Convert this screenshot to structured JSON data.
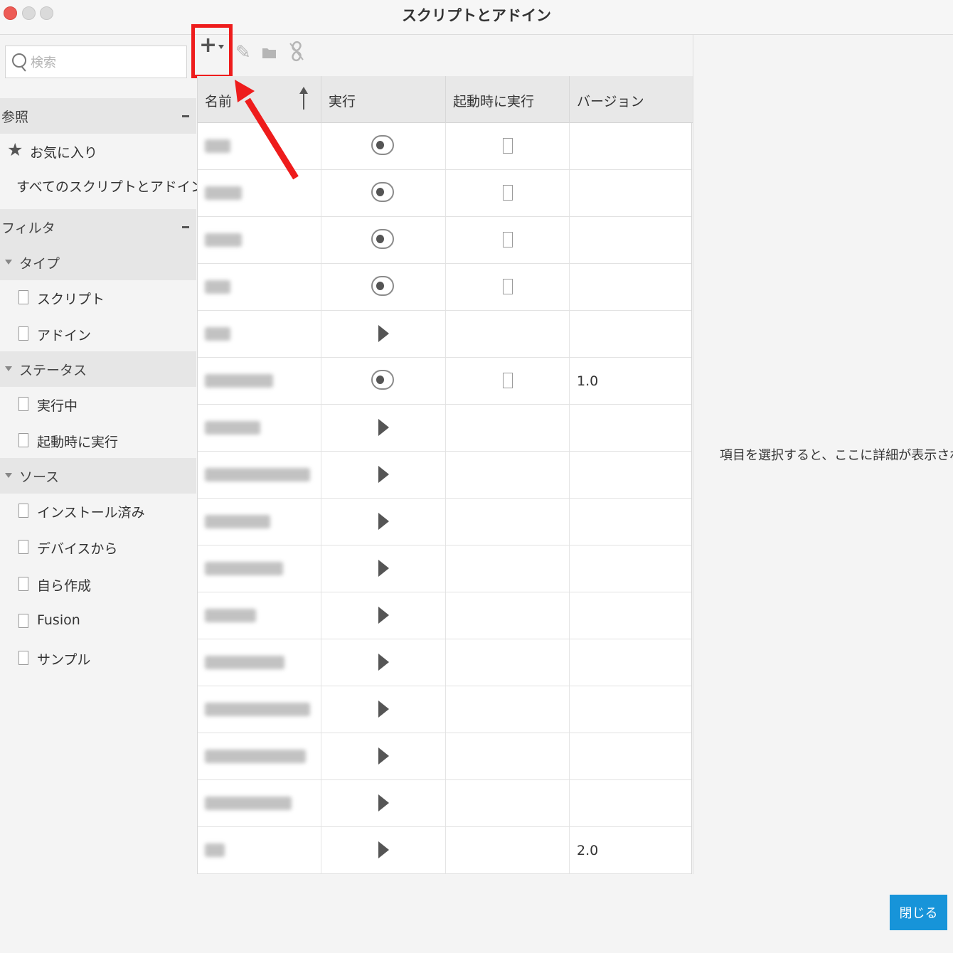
{
  "window": {
    "title": "スクリプトとアドイン"
  },
  "search": {
    "placeholder": "検索",
    "value": ""
  },
  "sidebar": {
    "browse": {
      "label": "参照",
      "collapse": "−",
      "items": [
        {
          "label": "お気に入り",
          "icon": "star-icon"
        },
        {
          "label": "すべてのスクリプトとアドイン"
        }
      ]
    },
    "filter": {
      "label": "フィルタ",
      "collapse": "−",
      "groups": [
        {
          "label": "タイプ",
          "options": [
            "スクリプト",
            "アドイン"
          ]
        },
        {
          "label": "ステータス",
          "options": [
            "実行中",
            "起動時に実行"
          ]
        },
        {
          "label": "ソース",
          "options": [
            "インストール済み",
            "デバイスから",
            "自ら作成",
            "Fusion",
            "サンプル"
          ]
        }
      ]
    }
  },
  "toolbar": {
    "add": "+",
    "icons": [
      "plus-icon",
      "pencil-icon",
      "folder-icon",
      "unlink-icon"
    ],
    "highlight_color": "#ee1c1c"
  },
  "table": {
    "columns": [
      "名前",
      "実行",
      "起動時に実行",
      "バージョン"
    ],
    "sort": {
      "column": "名前",
      "direction": "ascending"
    },
    "rows": [
      {
        "name_blurred": true,
        "run": "toggle",
        "on_startup": false,
        "version": ""
      },
      {
        "name_blurred": true,
        "run": "toggle",
        "on_startup": false,
        "version": ""
      },
      {
        "name_blurred": true,
        "run": "toggle",
        "on_startup": false,
        "version": ""
      },
      {
        "name_blurred": true,
        "run": "toggle",
        "on_startup": false,
        "version": ""
      },
      {
        "name_blurred": true,
        "run": "play",
        "on_startup": null,
        "version": ""
      },
      {
        "name_blurred": true,
        "run": "toggle",
        "on_startup": false,
        "version": "1.0"
      },
      {
        "name_blurred": true,
        "run": "play",
        "on_startup": null,
        "version": ""
      },
      {
        "name_blurred": true,
        "run": "play",
        "on_startup": null,
        "version": ""
      },
      {
        "name_blurred": true,
        "run": "play",
        "on_startup": null,
        "version": ""
      },
      {
        "name_blurred": true,
        "run": "play",
        "on_startup": null,
        "version": ""
      },
      {
        "name_blurred": true,
        "run": "play",
        "on_startup": null,
        "version": ""
      },
      {
        "name_blurred": true,
        "run": "play",
        "on_startup": null,
        "version": ""
      },
      {
        "name_blurred": true,
        "run": "play",
        "on_startup": null,
        "version": ""
      },
      {
        "name_blurred": true,
        "run": "play",
        "on_startup": null,
        "version": ""
      },
      {
        "name_blurred": true,
        "run": "play",
        "on_startup": null,
        "version": ""
      },
      {
        "name_blurred": true,
        "run": "play",
        "on_startup": null,
        "version": "2.0"
      }
    ]
  },
  "detail": {
    "message": "項目を選択すると、ここに詳細が表示されます"
  },
  "footer": {
    "close_label": "閉じる",
    "accent": "#1794d9"
  }
}
